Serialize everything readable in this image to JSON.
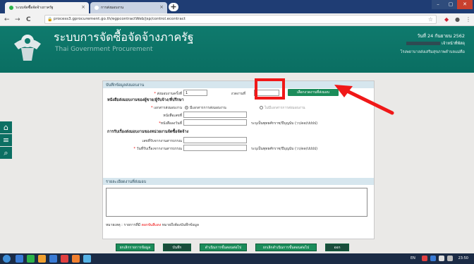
{
  "browser": {
    "tabs": [
      {
        "title": "ระบบจัดซื้อจัดจ้างภาครัฐ",
        "favicon_color": "#2db34a"
      },
      {
        "title": "การส่งมอบงาน",
        "favicon_color": "#ffffff"
      }
    ],
    "new_tab_symbol": "+",
    "window_controls": [
      "–",
      "▢",
      "✕"
    ],
    "nav": {
      "back": "←",
      "forward": "→",
      "reload": "C"
    },
    "url": "process3.gprocurement.go.th/egpcontractWeb/jsp/control.econtract",
    "lock_symbol": "🔒",
    "bookmark_symbol": "☆"
  },
  "header": {
    "title": "ระบบการจัดซื้อจัดจ้างภาครัฐ",
    "subtitle": "Thai Government Procurement",
    "date": "วันที่ 24 กันยายน 2562",
    "user_suffix": "เจ้าหน้าที่พัสดุ",
    "department": "โรงพยาบาลส่งเสริมสุขภาพตำบลแม่คือ"
  },
  "side_icons": [
    {
      "name": "home",
      "glyph": "⌂"
    },
    {
      "name": "menu",
      "glyph": "≡"
    },
    {
      "name": "search",
      "glyph": "⌕"
    }
  ],
  "form": {
    "section1": "บันทึกข้อมูลส่งมอบงาน",
    "delivery_no_label": "ส่งมอบงานครั้งที่",
    "delivery_no_value": "1",
    "installment_label": "งวดงานที่",
    "installment_value": "",
    "select_installment_btn": "เลือกงวดงานที่ส่งมอบ",
    "letter_heading": "หนังสือส่งมอบงานของผู้ขาย/ผู้รับจ้าง/ที่ปรึกษา",
    "doc_type_label": "เอกสารส่งมอบงาน",
    "doc_type_options": [
      "มีเอกสารการส่งมอบงาน",
      "ไม่มีเอกสารการส่งมอบงาน"
    ],
    "letter_no_label": "หนังสือเลขที่",
    "letter_no_value": "",
    "letter_date_label": "หนังสือลงวันที่",
    "letter_date_value": "",
    "date_hint": "ระบุเป็นพุทธศักราช/ปีบุญนับ (วว/ดด/ปปปป)",
    "receive_heading": "การรับเรื่องส่งมอบงานของหน่วยงานจัดซื้อจัดจ้าง",
    "receipt_no_label": "เลขที่รับจากงานสารบรรณ",
    "receipt_no_value": "",
    "receipt_date_label": "วันที่รับเรื่องจากงานสารบรรณ",
    "receipt_date_value": "",
    "receipt_date_hint": "ระบุเป็นพุทธศักราช/ปีบุญนับ (วว/ดด/ปปปป)",
    "details_heading": "รายละเอียดงานที่ส่งมอบ",
    "details_value": "",
    "note_prefix": "หมายเหตุ : รายการที่มี",
    "note_highlight": "ดอกจันสีแดง",
    "note_suffix": "หมายถึงต้องบันทึกข้อมูล"
  },
  "buttons": {
    "cancel": "ยกเลิกรายการข้อมูล",
    "save": "บันทึก",
    "proceed": "ดำเนินการขั้นตอนต่อไป",
    "cancel_proceed": "ยกเลิกดำเนินการขั้นตอนต่อไป",
    "exit": "ออก"
  },
  "footer": "กรมบัญชีกลาง (กบค.) กองบัญชีกลาง ถนนพระราม 6 แขวงพญาไท เขตพญาไท กรุงเทพมหานคร 10400 โทร. 02-127-7000 ต่อ 6704 4674 4958 6777 6828 6934 6800  PCON0004",
  "taskbar": {
    "language": "EN",
    "time": "23:50",
    "icon_colors": [
      "#3a7bd5",
      "#2db34a",
      "#f0a030",
      "#3a7bd5",
      "#e04040",
      "#f08030",
      "#56b3e6"
    ]
  },
  "colors": {
    "accent_green": "#1b8c5a",
    "header_teal": "#0f7a6d",
    "annotation_red": "#f01818"
  }
}
